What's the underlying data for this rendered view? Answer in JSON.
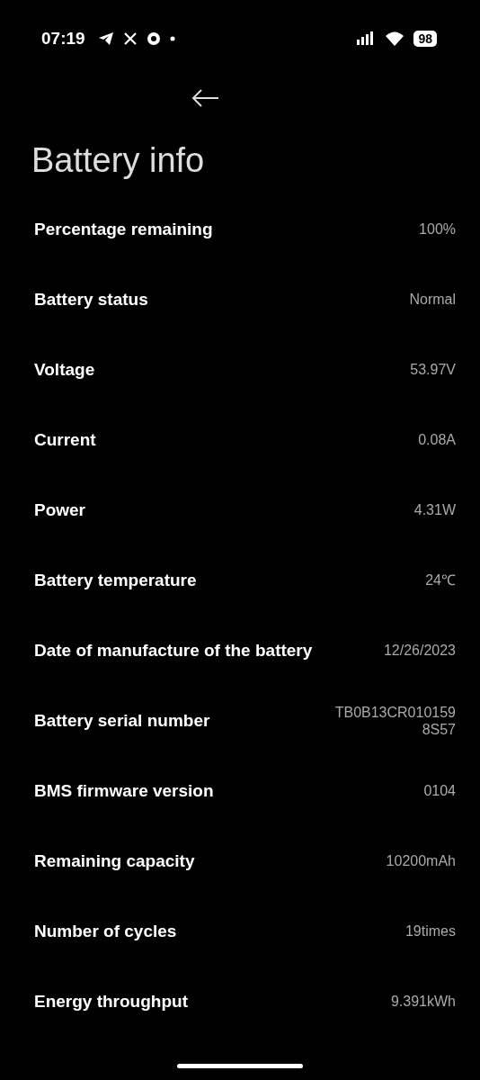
{
  "status_bar": {
    "time": "07:19",
    "battery": "98"
  },
  "title": "Battery info",
  "rows": [
    {
      "label": "Percentage remaining",
      "value": "100%"
    },
    {
      "label": "Battery status",
      "value": "Normal"
    },
    {
      "label": "Voltage",
      "value": "53.97V"
    },
    {
      "label": "Current",
      "value": "0.08A"
    },
    {
      "label": "Power",
      "value": "4.31W"
    },
    {
      "label": "Battery temperature",
      "value": "24℃"
    },
    {
      "label": "Date of manufacture of the battery",
      "value": "12/26/2023"
    },
    {
      "label": "Battery serial number",
      "value": "TB0B13CR010159\n8S57"
    },
    {
      "label": "BMS firmware version",
      "value": "0104"
    },
    {
      "label": "Remaining capacity",
      "value": "10200mAh"
    },
    {
      "label": "Number of cycles",
      "value": "19times"
    },
    {
      "label": "Energy throughput",
      "value": "9.391kWh"
    }
  ]
}
